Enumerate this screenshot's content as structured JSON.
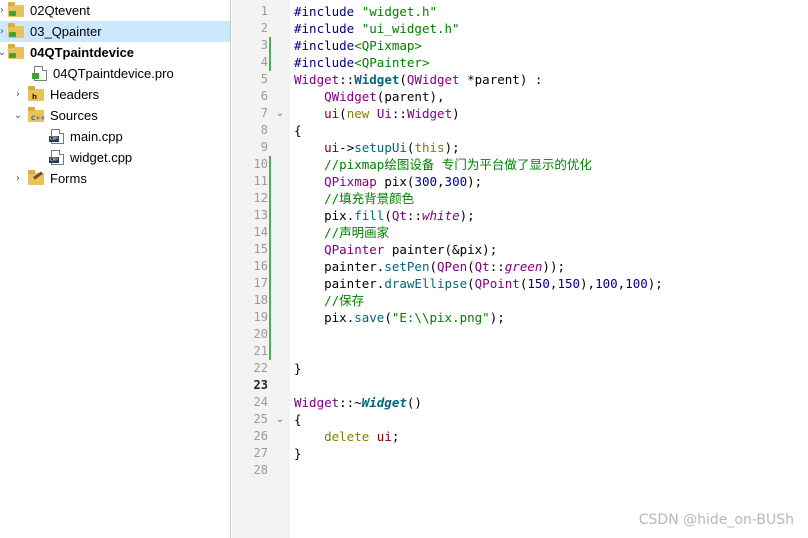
{
  "tree": {
    "items": [
      {
        "label": "02Qtevent",
        "chev": "›",
        "indent": 0
      },
      {
        "label": "03_Qpainter",
        "chev": "›",
        "indent": 0
      },
      {
        "label": "04QTpaintdevice",
        "chev": "⌄",
        "indent": 0
      },
      {
        "label": "04QTpaintdevice.pro"
      },
      {
        "label": "Headers",
        "chev": "›"
      },
      {
        "label": "Sources",
        "chev": "⌄"
      },
      {
        "label": "main.cpp"
      },
      {
        "label": "widget.cpp"
      },
      {
        "label": "Forms",
        "chev": "›"
      }
    ]
  },
  "editor": {
    "line_numbers": [
      "1",
      "2",
      "3",
      "4",
      "5",
      "6",
      "7",
      "8",
      "9",
      "10",
      "11",
      "12",
      "13",
      "14",
      "15",
      "16",
      "17",
      "18",
      "19",
      "20",
      "21",
      "22",
      "23",
      "24",
      "25",
      "26",
      "27",
      "28"
    ],
    "fold_markers": [
      "⌄",
      "⌄"
    ],
    "code": {
      "l1": [
        "#include",
        " ",
        "\"widget.h\""
      ],
      "l2": [
        "#include",
        " ",
        "\"ui_widget.h\""
      ],
      "l3": [
        "#include",
        "<QPixmap>"
      ],
      "l4": [
        "#include",
        "<QPainter>"
      ],
      "l5": [
        "Widget",
        "::",
        "Widget",
        "(",
        "QWidget",
        " *",
        "parent",
        ") :"
      ],
      "l6": [
        "    ",
        "QWidget",
        "(",
        "parent",
        "),"
      ],
      "l7": [
        "    ",
        "ui",
        "(",
        "new",
        " ",
        "Ui",
        "::",
        "Widget",
        ")"
      ],
      "l8": [
        "{"
      ],
      "l9": [
        "    ",
        "ui",
        "->",
        "setupUi",
        "(",
        "this",
        ");"
      ],
      "l10": [
        "    ",
        "//pixmap绘图设备 专门为平台做了显示的优化"
      ],
      "l11": [
        "    ",
        "QPixmap",
        " pix(",
        "300",
        ",",
        "300",
        ");"
      ],
      "l12": [
        "    ",
        "//填充背景颜色"
      ],
      "l13": [
        "    ",
        "pix",
        ".",
        "fill",
        "(",
        "Qt",
        "::",
        "white",
        ");"
      ],
      "l14": [
        "    ",
        "//声明画家"
      ],
      "l15": [
        "    ",
        "QPainter",
        " painter(&",
        "pix",
        ");"
      ],
      "l16": [
        "    ",
        "painter",
        ".",
        "setPen",
        "(",
        "QPen",
        "(",
        "Qt",
        "::",
        "green",
        "));"
      ],
      "l17": [
        "    ",
        "painter",
        ".",
        "drawEllipse",
        "(",
        "QPoint",
        "(",
        "150",
        ",",
        "150",
        "),",
        "100",
        ",",
        "100",
        ");"
      ],
      "l18": [
        "    ",
        "//保存"
      ],
      "l19": [
        "    ",
        "pix",
        ".",
        "save",
        "(",
        "\"E:\\\\pix.png\"",
        ");"
      ],
      "l22": [
        "}"
      ],
      "l24": [
        "Widget",
        "::~",
        "Widget",
        "()"
      ],
      "l25": [
        "{"
      ],
      "l26": [
        "    ",
        "delete",
        " ",
        "ui",
        ";"
      ],
      "l27": [
        "}"
      ]
    }
  },
  "watermark": "CSDN @hide_on-BUSh",
  "colors": {
    "selection": "#cce8ff",
    "gutter": "#f3f3f3",
    "change_marker": "#4caf50"
  }
}
